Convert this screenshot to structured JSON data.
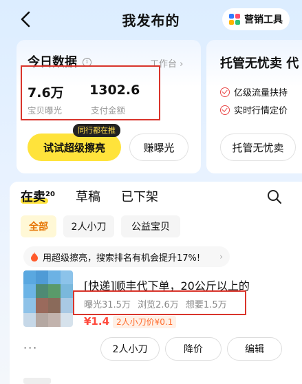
{
  "header": {
    "title": "我发布的",
    "marketing_label": "营销工具"
  },
  "today_card": {
    "title": "今日数据",
    "workbench_link": "工作台",
    "exposure_value": "7.6万",
    "exposure_label": "宝贝曝光",
    "payment_value": "1302.6",
    "payment_label": "支付金额",
    "push_tag": "同行都在推",
    "primary_button": "试试超级擦亮",
    "secondary_button": "赚曝光"
  },
  "managed_card": {
    "title": "托管无忧卖",
    "title_suffix": "代",
    "features": [
      "亿级流量扶持",
      "实时行情定价"
    ],
    "button": "托管无忧卖"
  },
  "tabs": [
    {
      "label": "在卖",
      "count": "20"
    },
    {
      "label": "草稿"
    },
    {
      "label": "已下架"
    }
  ],
  "filters": [
    "全部",
    "2人小刀",
    "公益宝贝"
  ],
  "tip": {
    "text": "用超级擦亮，搜索排名有机会提升17%!",
    "arrow": "›"
  },
  "item": {
    "title": "[快递]顺丰代下单，20公斤以上的",
    "stats": [
      "曝光31.5万",
      "浏览2.6万",
      "想要1.5万"
    ],
    "price": "¥1.4",
    "price_tag": "2人小刀价¥0.1",
    "more": "···",
    "actions": [
      "2人小刀",
      "降价",
      "编辑"
    ]
  },
  "colors": {
    "accent_yellow": "#ffe33b",
    "highlight_red": "#d9342b",
    "price_red": "#ff4a3d"
  }
}
